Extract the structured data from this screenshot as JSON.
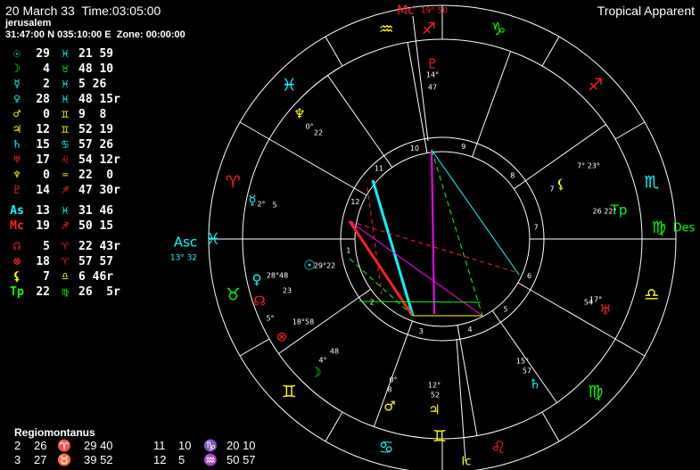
{
  "header": {
    "date_time": "20 March 33  Time:03:05:00",
    "place": "jerusalem",
    "coords": "31:47:00 N 035:10:00 E  Zone: 00:00:00",
    "mode": "Tropical Apparent"
  },
  "colors": {
    "cyan": "#00ffff",
    "yellow": "#ffff00",
    "green": "#00ff00",
    "red": "#ff2020",
    "magenta": "#ff00ff",
    "white": "#ffffff"
  },
  "planets": [
    {
      "glyph": "☉",
      "color": "#00ffff",
      "deg": "29",
      "sign": "♓",
      "sign_color": "#00ffff",
      "min": "21 59"
    },
    {
      "glyph": "☽",
      "color": "#00ff00",
      "deg": "4",
      "sign": "♉",
      "sign_color": "#00ff00",
      "min": "48 10"
    },
    {
      "glyph": "☿",
      "color": "#00ffff",
      "deg": "2",
      "sign": "♓",
      "sign_color": "#00ffff",
      "min": "5 26"
    },
    {
      "glyph": "♀",
      "color": "#00ffff",
      "deg": "28",
      "sign": "♓",
      "sign_color": "#00ffff",
      "min": "48 15r"
    },
    {
      "glyph": "♂",
      "color": "#ffff00",
      "deg": "0",
      "sign": "♊",
      "sign_color": "#ffff00",
      "min": "9  8"
    },
    {
      "glyph": "♃",
      "color": "#ffff00",
      "deg": "12",
      "sign": "♊",
      "sign_color": "#ffff00",
      "min": "52 19"
    },
    {
      "glyph": "♄",
      "color": "#00ffff",
      "deg": "15",
      "sign": "♋",
      "sign_color": "#00ffff",
      "min": "57 26"
    },
    {
      "glyph": "♅",
      "color": "#ff2020",
      "deg": "17",
      "sign": "♌",
      "sign_color": "#ff2020",
      "min": "54 12r"
    },
    {
      "glyph": "♆",
      "color": "#ffff00",
      "deg": "0",
      "sign": "♒",
      "sign_color": "#ffff00",
      "min": "22  0"
    },
    {
      "glyph": "♇",
      "color": "#ff2020",
      "deg": "14",
      "sign": "♐",
      "sign_color": "#ff2020",
      "min": "47 30r"
    },
    {
      "gap": true
    },
    {
      "glyph": "As",
      "color": "#00ffff",
      "deg": "13",
      "sign": "♓",
      "sign_color": "#00ffff",
      "min": "31 46"
    },
    {
      "glyph": "Mc",
      "color": "#ff2020",
      "deg": "19",
      "sign": "♐",
      "sign_color": "#ff2020",
      "min": "50 15"
    },
    {
      "gap": true
    },
    {
      "glyph": "☊",
      "color": "#ff2020",
      "deg": "5",
      "sign": "♈",
      "sign_color": "#ff2020",
      "min": "22 43r"
    },
    {
      "glyph": "⊗",
      "color": "#ff2020",
      "deg": "18",
      "sign": "♈",
      "sign_color": "#ff2020",
      "min": "57 57"
    },
    {
      "glyph": "⚸",
      "color": "#ffff00",
      "deg": "7",
      "sign": "♎",
      "sign_color": "#ffff00",
      "min": "6 46r"
    },
    {
      "glyph": "Tp",
      "color": "#00ff00",
      "deg": "22",
      "sign": "♍",
      "sign_color": "#00ff00",
      "min": "26  5r"
    }
  ],
  "houses": {
    "title": "Regiomontanus",
    "rows": [
      {
        "h1": "2",
        "d1": "26",
        "s1": "♈",
        "m1": "29 40",
        "h2": "11",
        "d2": "10",
        "s2": "♑",
        "m2": "20 10",
        "c1": "#ff2020",
        "c2": "#00ff00"
      },
      {
        "h1": "3",
        "d1": "27",
        "s1": "♉",
        "m1": "39 52",
        "h2": "12",
        "d2": "5",
        "s2": "♒",
        "m2": "50 57",
        "c1": "#00ff00",
        "c2": "#ffff00"
      }
    ]
  },
  "wheel": {
    "asc_label": "Asc",
    "asc_value": "13° 32",
    "des_label": "Des",
    "mc_label": "Mc",
    "mc_value": "19° 50",
    "ic_label": "Ic",
    "sign_ring": [
      {
        "g": "♒",
        "c": "#ffff00"
      },
      {
        "g": "♑",
        "c": "#00ff00"
      },
      {
        "g": "♐",
        "c": "#ff2020"
      },
      {
        "g": "♏",
        "c": "#00ffff"
      },
      {
        "g": "♎",
        "c": "#ffff00"
      },
      {
        "g": "♍",
        "c": "#00ff00"
      },
      {
        "g": "♌",
        "c": "#ff2020"
      },
      {
        "g": "♋",
        "c": "#00ffff"
      },
      {
        "g": "♊",
        "c": "#ffff00"
      },
      {
        "g": "♉",
        "c": "#00ff00"
      },
      {
        "g": "♈",
        "c": "#ff2020"
      },
      {
        "g": "♓",
        "c": "#00ffff"
      }
    ],
    "house_numbers": [
      "1",
      "2",
      "3",
      "4",
      "5",
      "6",
      "7",
      "8",
      "9",
      "10",
      "11",
      "12"
    ],
    "bodies": [
      {
        "g": "♇",
        "c": "#ff2020",
        "d": "14°",
        "m": "47"
      },
      {
        "g": "♆",
        "c": "#ffff00",
        "d": "0°",
        "m": "22"
      },
      {
        "g": "⚸",
        "c": "#ffff00",
        "d": "7",
        "m": "7° 23°"
      },
      {
        "g": "Tp",
        "c": "#00ff00",
        "d": "26 22°",
        "m": ""
      },
      {
        "g": "☿",
        "c": "#00ffff",
        "d": "2°",
        "m": "5"
      },
      {
        "g": "♀",
        "c": "#00ffff",
        "d": "28°48",
        "m": "23"
      },
      {
        "g": "☉",
        "c": "#00ffff",
        "d": "29°22",
        "m": ""
      },
      {
        "g": "☊",
        "c": "#ff2020",
        "d": "5°",
        "m": ""
      },
      {
        "g": "⊗",
        "c": "#ff2020",
        "d": "18°58",
        "m": ""
      },
      {
        "g": "♅",
        "c": "#ff2020",
        "d": "54",
        "m": "17°"
      },
      {
        "g": "☽",
        "c": "#00ff00",
        "d": "4°",
        "m": "48"
      },
      {
        "g": "♂",
        "c": "#ffff00",
        "d": "8",
        "m": "0°"
      },
      {
        "g": "♃",
        "c": "#ffff00",
        "d": "52",
        "m": "12°"
      },
      {
        "g": "♄",
        "c": "#00ffff",
        "d": "57",
        "m": "15°"
      }
    ]
  }
}
